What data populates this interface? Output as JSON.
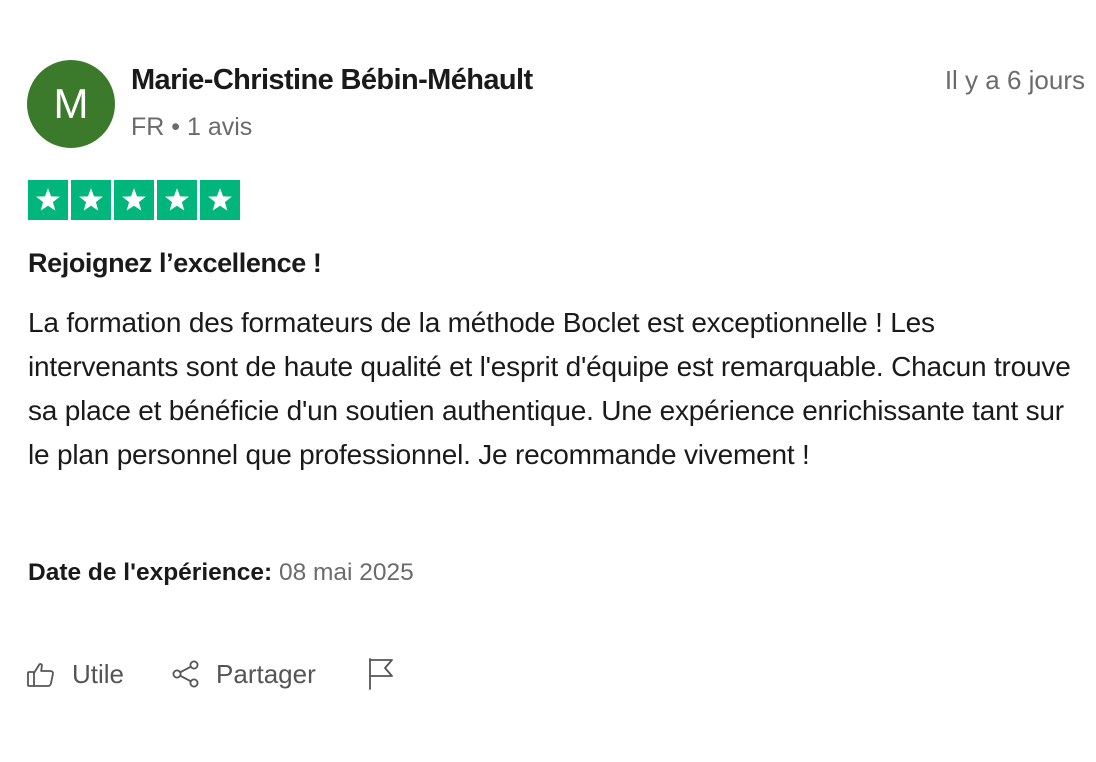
{
  "reviewer": {
    "avatar_letter": "M",
    "avatar_color": "#3a7a2a",
    "name": "Marie-Christine Bébin-Méhault",
    "meta": "FR • 1 avis"
  },
  "review": {
    "time_ago": "Il y a 6 jours",
    "rating": 5,
    "max_rating": 5,
    "star_color": "#00b67a",
    "title": "Rejoignez l’excellence !",
    "body": "La formation des formateurs de la méthode Boclet est exceptionnelle ! Les intervenants sont de haute qualité et l'esprit d'équipe est remarquable. Chacun trouve sa place et bénéficie d'un soutien authentique. Une expérience enrichissante tant sur le plan personnel que professionnel. Je recommande vivement !",
    "experience_label": "Date de l'expérience:",
    "experience_date": "08 mai 2025"
  },
  "actions": {
    "useful_label": "Utile",
    "useful_icon": "thumbs-up-icon",
    "share_label": "Partager",
    "share_icon": "share-icon",
    "flag_icon": "flag-icon"
  }
}
